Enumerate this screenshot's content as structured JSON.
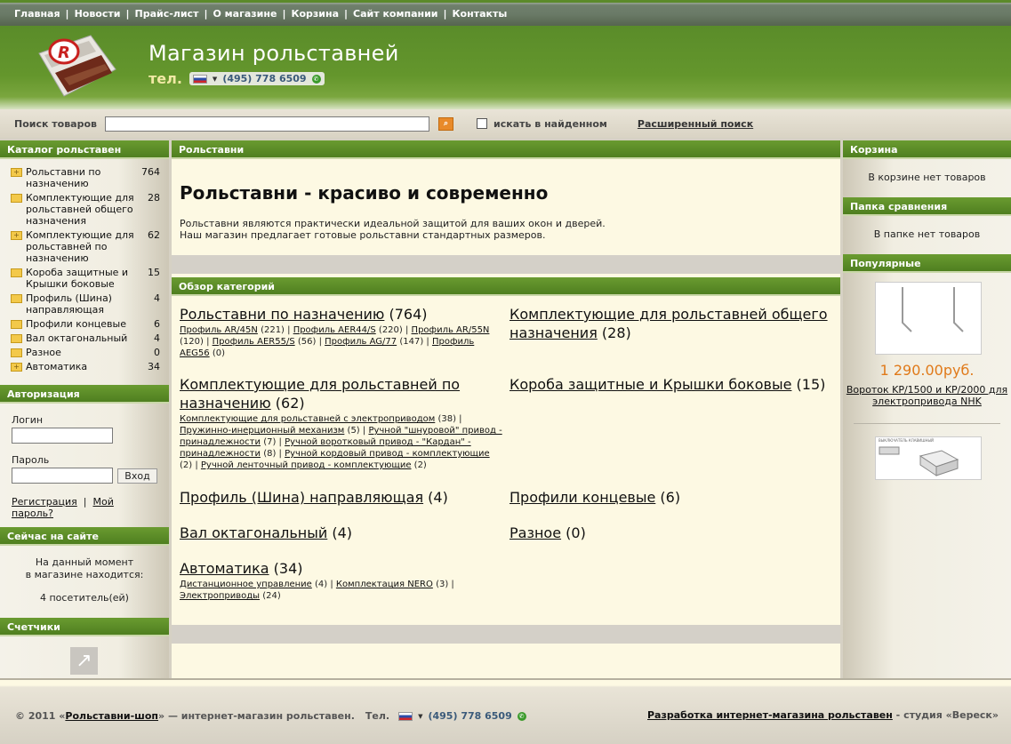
{
  "nav": {
    "items": [
      "Главная",
      "Новости",
      "Прайс-лист",
      "О магазине",
      "Корзина",
      "Сайт компании",
      "Контакты"
    ]
  },
  "header": {
    "title": "Магазин рольставней",
    "tel_label": "тел.",
    "phone": "(495) 778 6509"
  },
  "search": {
    "label": "Поиск товаров",
    "value": "",
    "in_found_label": "искать в найденном",
    "advanced_label": "Расширенный поиск"
  },
  "catalog": {
    "title": "Каталог рольставен",
    "items": [
      {
        "name": "Рольставни по назначению",
        "count": "764"
      },
      {
        "name": "Комплектующие для рольставней общего назначения",
        "count": "28"
      },
      {
        "name": "Комплектующие для рольставней по назначению",
        "count": "62"
      },
      {
        "name": "Короба защитные и Крышки боковые",
        "count": "15"
      },
      {
        "name": "Профиль (Шина) направляющая",
        "count": "4"
      },
      {
        "name": "Профили концевые",
        "count": "6"
      },
      {
        "name": "Вал октагональный",
        "count": "4"
      },
      {
        "name": "Разное",
        "count": "0"
      },
      {
        "name": "Автоматика",
        "count": "34"
      }
    ]
  },
  "auth": {
    "title": "Авторизация",
    "login_label": "Логин",
    "password_label": "Пароль",
    "submit_label": "Вход",
    "register_label": "Регистрация",
    "forgot_label": "Мой пароль?"
  },
  "online": {
    "title": "Сейчас на сайте",
    "line1": "На данный момент",
    "line2": "в магазине находится:",
    "visitors": "4 посетитель(ей)"
  },
  "counters": {
    "title": "Счетчики"
  },
  "main": {
    "breadcrumb": "Рольставни",
    "heading": "Рольставни - красиво и современно",
    "intro1": "Рольставни являются практически идеальной защитой для ваших окон и дверей.",
    "intro2": "Наш магазин предлагает готовые рольставни стандартных размеров.",
    "overview_title": "Обзор категорий",
    "categories": [
      {
        "name": "Рольставни по назначению",
        "count": "(764)",
        "sub": [
          [
            "Профиль AR/45N",
            "(221)"
          ],
          [
            "Профиль AER44/S",
            "(220)"
          ],
          [
            "Профиль AR/55N",
            "(120)"
          ],
          [
            "Профиль AER55/S",
            "(56)"
          ],
          [
            "Профиль AG/77",
            "(147)"
          ],
          [
            "Профиль AEG56",
            "(0)"
          ]
        ]
      },
      {
        "name": "Комплектующие для рольставней общего назначения",
        "count": "(28)",
        "sub": []
      },
      {
        "name": "Комплектующие для рольставней по назначению",
        "count": "(62)",
        "sub": [
          [
            "Комплектующие для рольставней с электроприводом",
            "(38)"
          ],
          [
            "Пружинно-инерционный механизм",
            "(5)"
          ],
          [
            "Ручной \"шнуровой\" привод - принадлежности",
            "(7)"
          ],
          [
            "Ручной воротковый привод - \"Кардан\" - принадлежности",
            "(8)"
          ],
          [
            "Ручной кордовый привод - комплектующие",
            "(2)"
          ],
          [
            "Ручной ленточный привод - комплектующие",
            "(2)"
          ]
        ]
      },
      {
        "name": "Короба защитные и Крышки боковые",
        "count": "(15)",
        "sub": []
      },
      {
        "name": "Профиль (Шина) направляющая",
        "count": "(4)",
        "sub": []
      },
      {
        "name": "Профили концевые",
        "count": "(6)",
        "sub": []
      },
      {
        "name": "Вал октагональный",
        "count": "(4)",
        "sub": []
      },
      {
        "name": "Разное",
        "count": "(0)",
        "sub": []
      },
      {
        "name": "Автоматика",
        "count": "(34)",
        "sub": [
          [
            "Дистанционное управление",
            "(4)"
          ],
          [
            "Комплектация NERO",
            "(3)"
          ],
          [
            "Электроприводы",
            "(24)"
          ]
        ]
      }
    ]
  },
  "right": {
    "cart_title": "Корзина",
    "cart_empty": "В корзине нет товаров",
    "compare_title": "Папка сравнения",
    "compare_empty": "В папке нет товаров",
    "popular_title": "Популярные",
    "popular_price": "1 290.00руб.",
    "popular_name": "Вороток KP/1500 и KP/2000 для электропривода NHK",
    "popular2_caption": "ВЫКЛЮЧАТЕЛЬ КЛАВИШНЫЙ"
  },
  "footer": {
    "copyright_prefix": "© 2011 «",
    "shop_link": "Рольставни-шоп",
    "copyright_suffix": "» — интернет-магазин рольставен.",
    "tel_label": "Тел.",
    "phone": "(495) 778 6509",
    "dev_link": "Разработка интернет-магазина рольставен",
    "dev_suffix": " - студия «Вереск»"
  },
  "colors": {
    "green": "#5a8c2a",
    "cream": "#fdf9e3",
    "price": "#e07a1a"
  }
}
